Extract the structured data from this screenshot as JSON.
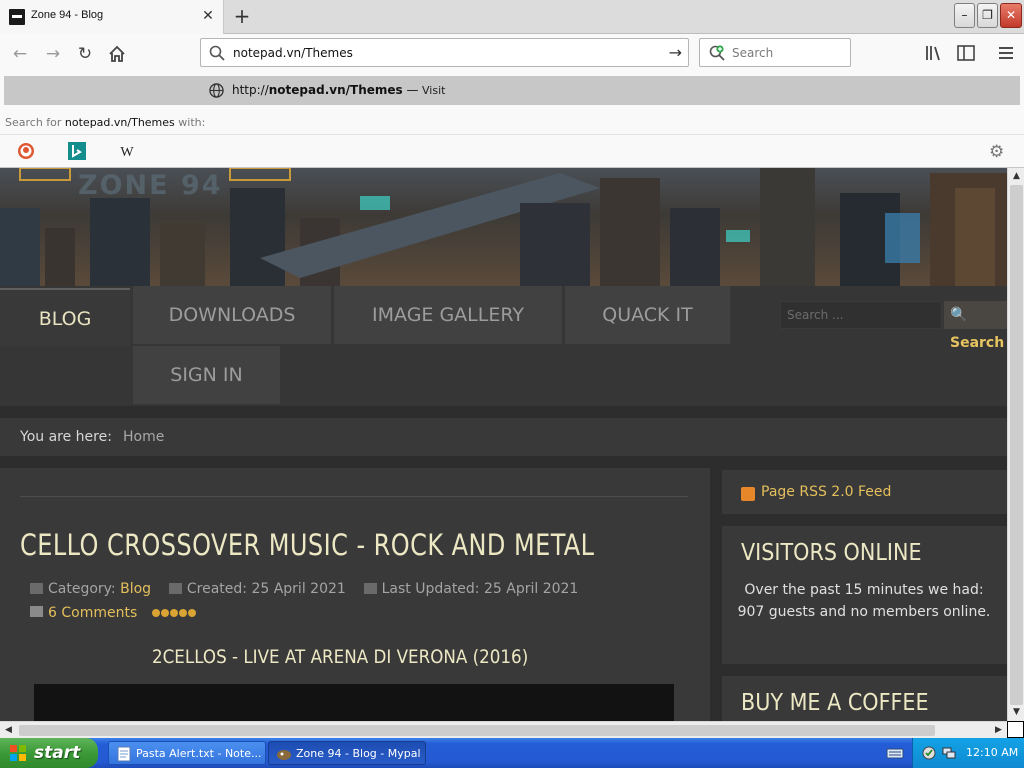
{
  "browser": {
    "tab_title": "Zone 94 - Blog",
    "tab_close": "✕",
    "new_tab": "+",
    "window_buttons": {
      "minimize": "–",
      "maximize": "❐",
      "close": "✕"
    },
    "url_value": "notepad.vn/Themes",
    "search_placeholder": "Search",
    "suggestion": {
      "prefix": "http://",
      "bold": "notepad.vn/Themes",
      "separator": "—",
      "action": "Visit"
    },
    "search_hint": {
      "before": "Search for ",
      "query": "notepad.vn/Themes",
      "after": " with:"
    },
    "engines": [
      "duckduckgo-icon",
      "bing-icon",
      "wikipedia-icon"
    ]
  },
  "site": {
    "logo": "ZONE 94",
    "menu": [
      {
        "label": "BLOG",
        "active": true
      },
      {
        "label": "DOWNLOADS",
        "active": false
      },
      {
        "label": "IMAGE GALLERY",
        "active": false
      },
      {
        "label": "QUACK IT",
        "active": false
      },
      {
        "label": "SIGN IN",
        "active": false
      }
    ],
    "search_placeholder": "Search ...",
    "search_button": "Search",
    "breadcrumb": {
      "label": "You are here:",
      "home": "Home"
    },
    "article": {
      "title": "CELLO CROSSOVER MUSIC - ROCK AND METAL",
      "category_label": "Category:",
      "category": "Blog",
      "created": "Created: 25 April 2021",
      "updated": "Last Updated: 25 April 2021",
      "comments": "6 Comments",
      "rating": 5,
      "subtitle": "2CELLOS - LIVE AT ARENA DI VERONA (2016)"
    },
    "sidebar": {
      "rss": "Page RSS 2.0 Feed",
      "visitors_title": "VISITORS ONLINE",
      "visitors_text": "Over the past 15 minutes we had: 907 guests and no members online.",
      "coffee_title": "BUY ME A COFFEE"
    }
  },
  "taskbar": {
    "start": "start",
    "tasks": [
      "Pasta Alert.txt - Note...",
      "Zone 94 - Blog - Mypal"
    ],
    "clock": "12:10 AM"
  },
  "colors": {
    "accent_gold": "#e4bf5b",
    "heading_cream": "#ede8c4",
    "page_bg": "#2d2d2d"
  }
}
